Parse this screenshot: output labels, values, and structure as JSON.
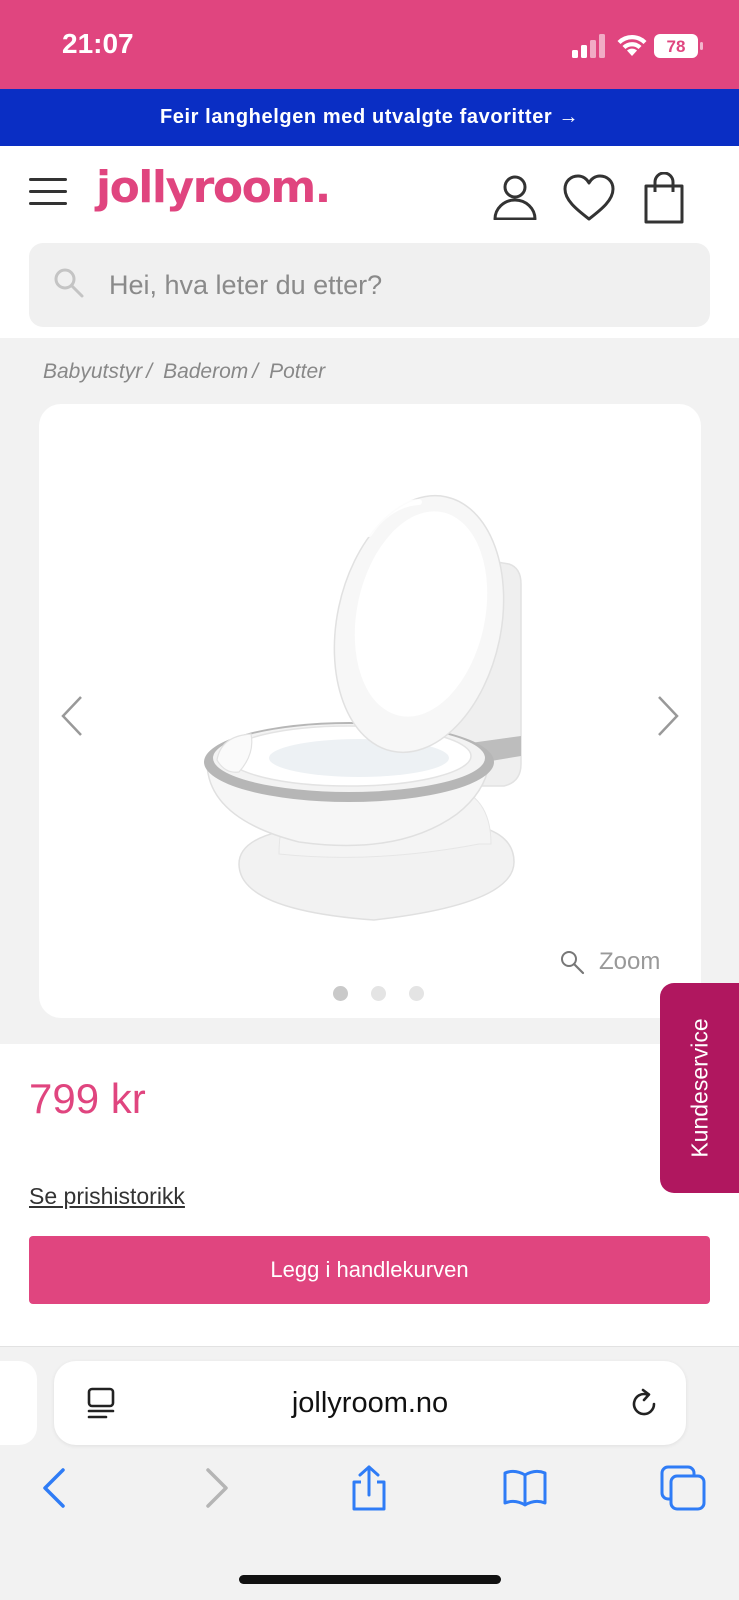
{
  "status_bar": {
    "time": "21:07",
    "battery": "78",
    "bg_color": "#e0457f"
  },
  "promo_banner": {
    "text": "Feir langhelgen med utvalgte favoritter →",
    "bg_color": "#0a2ec4"
  },
  "header": {
    "logo": "jollyroom.",
    "icons": [
      "menu-icon",
      "user-icon",
      "heart-icon",
      "shopping-bag-icon"
    ]
  },
  "search": {
    "placeholder": "Hei, hva leter du etter?"
  },
  "breadcrumb": {
    "items": [
      "Babyutstyr",
      "Baderom",
      "Potter"
    ],
    "separator": "/"
  },
  "gallery": {
    "zoom_label": "Zoom",
    "image_count": 3,
    "active_index": 0,
    "image_description": "white toy toilet potty with grey trim"
  },
  "product": {
    "price": "799 kr",
    "price_history_link": "Se prishistorikk",
    "add_to_cart_label": "Legg i handlekurven",
    "accent_color": "#e0457f"
  },
  "customer_service": {
    "label": "Kundeservice",
    "bg_color": "#b0175f"
  },
  "browser": {
    "url": "jollyroom.no",
    "nav_icons": [
      "back-icon",
      "forward-icon",
      "share-icon",
      "bookmarks-icon",
      "tabs-icon"
    ],
    "tint_color": "#2f7cf6"
  }
}
